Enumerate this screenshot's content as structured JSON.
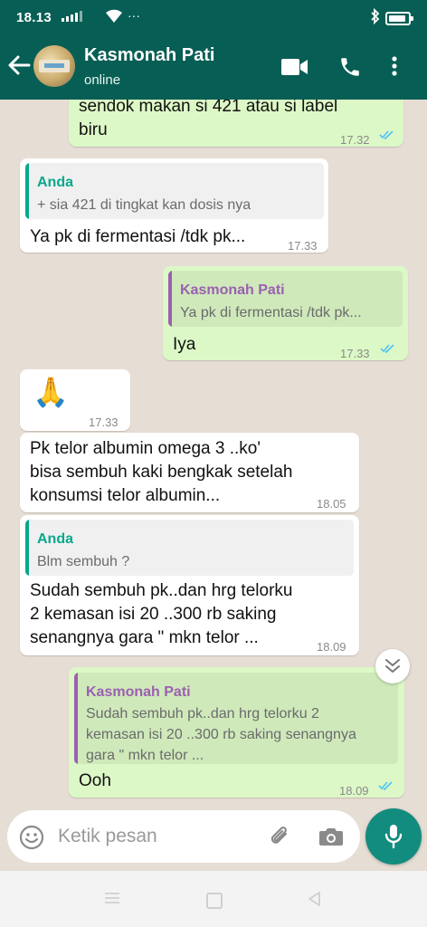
{
  "status_bar": {
    "time": "18.13",
    "dots": "···"
  },
  "header": {
    "contact_name": "Kasmonah Pati",
    "status": "online"
  },
  "colors": {
    "header": "#075e54",
    "outgoing_bubble": "#dcf8c6",
    "incoming_bubble": "#ffffff",
    "chat_background": "#e6ddd4",
    "read_ticks": "#4fc3f7",
    "accent": "#128c7e",
    "quote_anda": "#06a88a",
    "quote_kasmonah": "#9c5fb0"
  },
  "messages": [
    {
      "direction": "out",
      "lines": [
        "sendok makan si 421 atau si label",
        "biru"
      ],
      "time": "17.32",
      "read": true
    },
    {
      "direction": "in",
      "quote": {
        "author": "Anda",
        "text": "+ sia 421 di tingkat kan dosis nya"
      },
      "lines": [
        "Ya pk di fermentasi /tdk pk..."
      ],
      "time": "17.33"
    },
    {
      "direction": "out",
      "quote": {
        "author": "Kasmonah Pati",
        "text": "Ya pk di fermentasi /tdk pk..."
      },
      "lines": [
        "Iya"
      ],
      "time": "17.33",
      "read": true
    },
    {
      "direction": "in",
      "emoji": "🙏",
      "emoji_icon": "folded-hands-emoji",
      "time": "17.33"
    },
    {
      "direction": "in",
      "lines": [
        "Pk telor albumin omega 3 ..ko'",
        "bisa sembuh kaki bengkak setelah",
        "konsumsi telor albumin..."
      ],
      "time": "18.05"
    },
    {
      "direction": "in",
      "quote": {
        "author": "Anda",
        "text": "Blm sembuh ?"
      },
      "lines": [
        "Sudah sembuh pk..dan hrg telorku",
        "2 kemasan isi 20 ..300 rb saking",
        "senangnya gara \" mkn telor ..."
      ],
      "time": "18.09"
    },
    {
      "direction": "out",
      "quote": {
        "author": "Kasmonah Pati",
        "text_lines": [
          "Sudah sembuh pk..dan hrg telorku 2",
          "kemasan isi 20 ..300 rb saking senangnya",
          "gara \" mkn telor ..."
        ]
      },
      "lines": [
        "Ooh"
      ],
      "time": "18.09",
      "read": true
    }
  ],
  "composer": {
    "placeholder": "Ketik pesan"
  },
  "icons": {
    "back": "arrow-left-icon",
    "video": "video-camera-icon",
    "call": "phone-icon",
    "menu": "more-vert-icon",
    "emoji": "smiley-icon",
    "attach": "paperclip-icon",
    "camera": "camera-icon",
    "mic": "microphone-icon",
    "scroll_down": "double-chevron-down-icon"
  }
}
